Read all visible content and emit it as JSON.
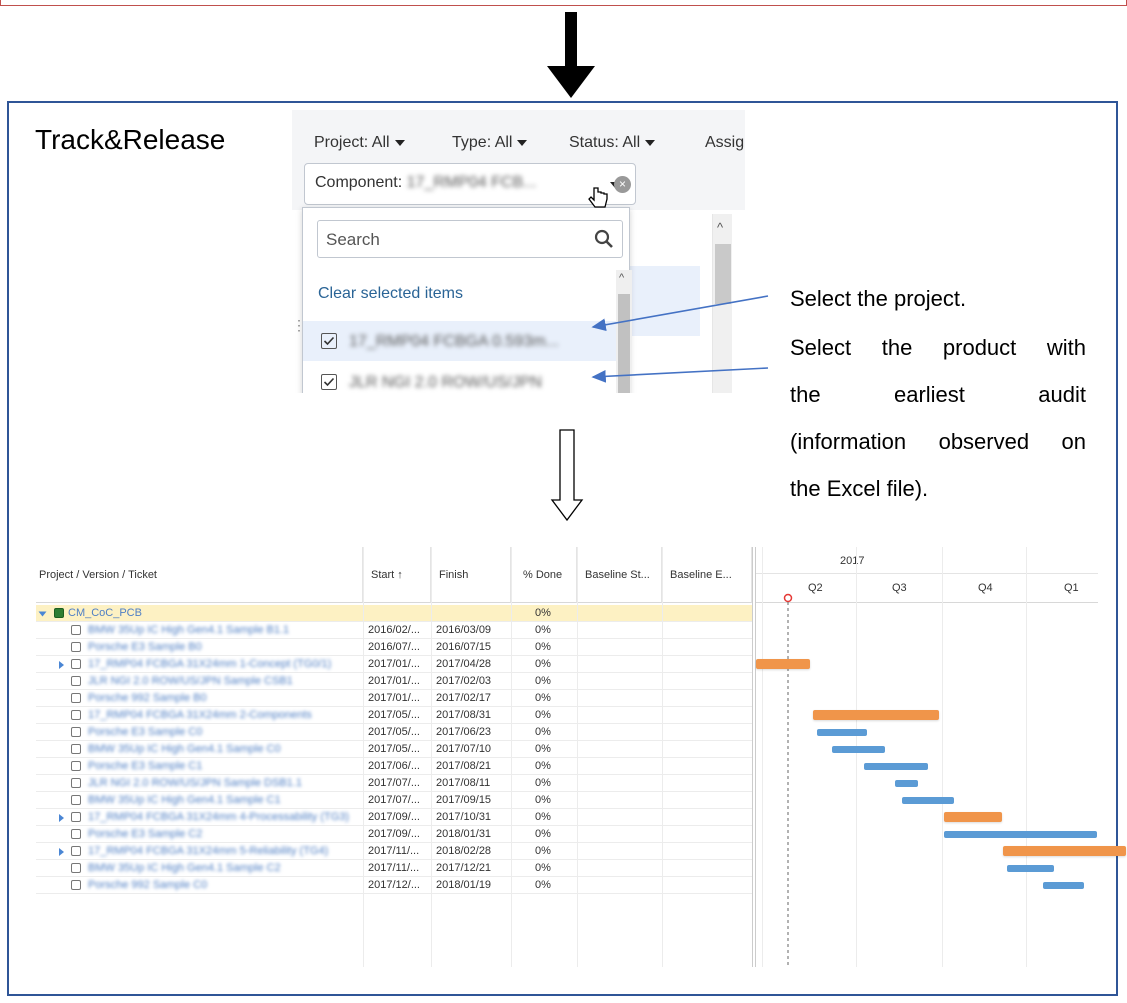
{
  "slide_title": "Track&Release",
  "jira": {
    "filters": [
      "Project: All",
      "Type: All",
      "Status: All",
      "Assig"
    ],
    "component_label": "Component:",
    "component_value": "17_RMP04 FCB...",
    "search_placeholder": "Search",
    "clear_selected": "Clear selected items",
    "items": [
      {
        "label": "17_RMP04 FCBGA 0.593m...",
        "checked": true
      },
      {
        "label": "JLR NGI 2.0 ROW/US/JPN",
        "checked": true
      }
    ]
  },
  "callouts": {
    "select_project": "Select the project.",
    "select_product_lines": [
      "Select the product with",
      "the earliest audit",
      "(information observed on",
      "the Excel file)."
    ]
  },
  "gantt": {
    "columns": [
      "Project / Version / Ticket",
      "Start ↑",
      "Finish",
      "% Done",
      "Baseline St...",
      "Baseline E..."
    ],
    "year": "2017",
    "quarters": [
      "Q2",
      "Q3",
      "Q4",
      "Q1"
    ],
    "rows": [
      {
        "name": "CM_CoC_PCB",
        "start": "",
        "finish": "",
        "done": "0%",
        "summary": true
      },
      {
        "name": "BMW 35Up IC High Gen4.1 Sample B1.1",
        "start": "2016/02/...",
        "finish": "2016/03/09",
        "done": "0%"
      },
      {
        "name": "Porsche E3 Sample B0",
        "start": "2016/07/...",
        "finish": "2016/07/15",
        "done": "0%"
      },
      {
        "name": "17_RMP04 FCBGA 31X24mm 1-Concept (TG0/1)",
        "start": "2017/01/...",
        "finish": "2017/04/28",
        "done": "0%",
        "expand": true
      },
      {
        "name": "JLR NGI 2.0 ROW/US/JPN Sample CSB1",
        "start": "2017/01/...",
        "finish": "2017/02/03",
        "done": "0%"
      },
      {
        "name": "Porsche 992 Sample B0",
        "start": "2017/01/...",
        "finish": "2017/02/17",
        "done": "0%"
      },
      {
        "name": "17_RMP04 FCBGA 31X24mm 2-Components",
        "start": "2017/05/...",
        "finish": "2017/08/31",
        "done": "0%"
      },
      {
        "name": "Porsche E3 Sample C0",
        "start": "2017/05/...",
        "finish": "2017/06/23",
        "done": "0%"
      },
      {
        "name": "BMW 35Up IC High Gen4.1 Sample C0",
        "start": "2017/05/...",
        "finish": "2017/07/10",
        "done": "0%"
      },
      {
        "name": "Porsche E3 Sample C1",
        "start": "2017/06/...",
        "finish": "2017/08/21",
        "done": "0%"
      },
      {
        "name": "JLR NGI 2.0 ROW/US/JPN Sample DSB1.1",
        "start": "2017/07/...",
        "finish": "2017/08/11",
        "done": "0%"
      },
      {
        "name": "BMW 35Up IC High Gen4.1 Sample C1",
        "start": "2017/07/...",
        "finish": "2017/09/15",
        "done": "0%"
      },
      {
        "name": "17_RMP04 FCBGA 31X24mm 4-Processability (TG3)",
        "start": "2017/09/...",
        "finish": "2017/10/31",
        "done": "0%",
        "expand": true
      },
      {
        "name": "Porsche E3 Sample C2",
        "start": "2017/09/...",
        "finish": "2018/01/31",
        "done": "0%"
      },
      {
        "name": "17_RMP04 FCBGA 31X24mm 5-Reliability (TG4)",
        "start": "2017/11/...",
        "finish": "2018/02/28",
        "done": "0%",
        "expand": true
      },
      {
        "name": "BMW 35Up IC High Gen4.1 Sample C2",
        "start": "2017/11/...",
        "finish": "2017/12/21",
        "done": "0%"
      },
      {
        "name": "Porsche 992 Sample C0",
        "start": "2017/12/...",
        "finish": "2018/01/19",
        "done": "0%"
      }
    ]
  },
  "colors": {
    "frame": "#2f5597",
    "summary_row": "#fdf1c3",
    "bar_orange": "#f0954a",
    "bar_blue": "#5b9bd5"
  }
}
